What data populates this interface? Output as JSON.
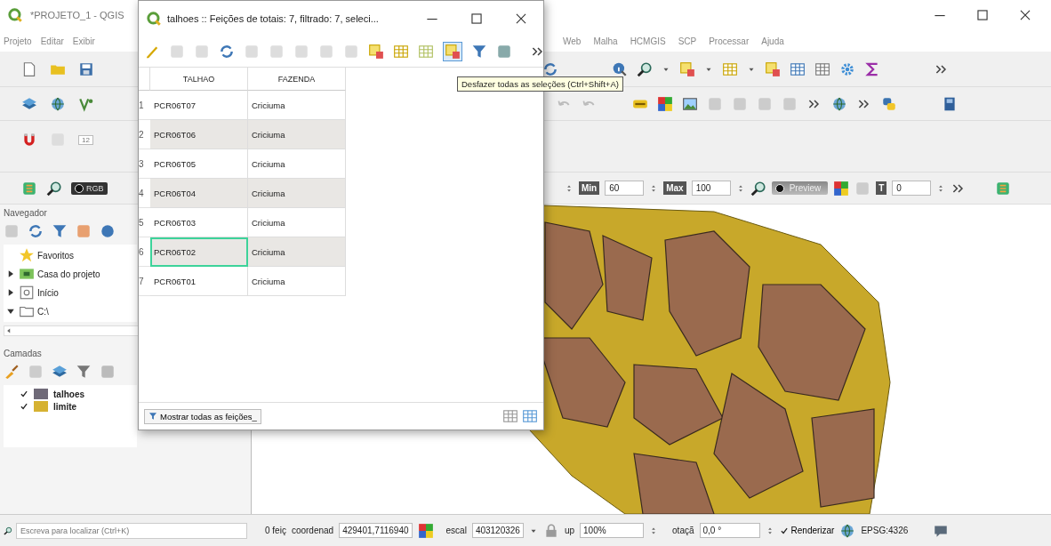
{
  "main_window": {
    "title": "*PROJETO_1 - QGIS"
  },
  "menu_left": [
    "Projeto",
    "Editar",
    "Exibir"
  ],
  "menu_right": [
    "Web",
    "Malha",
    "HCMGIS",
    "SCP",
    "Processar",
    "Ajuda"
  ],
  "raster_toolbar": {
    "band_combo": "RGB",
    "snap_value": "12",
    "min_label": "Min",
    "min_value": "60",
    "max_label": "Max",
    "max_value": "100",
    "preview_label": "Preview",
    "t_label": "T",
    "t_value": "0"
  },
  "browser_panel": {
    "title": "Navegador",
    "items": [
      {
        "label": "Favoritos",
        "kind": "favorites"
      },
      {
        "label": "Casa do projeto",
        "kind": "project",
        "expanded": false
      },
      {
        "label": "Início",
        "kind": "home",
        "expanded": false
      },
      {
        "label": "C:\\",
        "kind": "drive",
        "expanded": true
      }
    ]
  },
  "layers_panel": {
    "title": "Camadas",
    "layers": [
      {
        "name": "talhoes",
        "checked": true,
        "color": "#6f6a78"
      },
      {
        "name": "limite",
        "checked": true,
        "color": "#d6b232"
      }
    ]
  },
  "attribute_table": {
    "title": "talhoes :: Feições de totais: 7, filtrado: 7, seleci...",
    "columns": [
      "TALHAO",
      "FAZENDA"
    ],
    "rows": [
      {
        "number": "1",
        "talhao": "PCR06T07",
        "fazenda": "Criciuma",
        "current": false
      },
      {
        "number": "2",
        "talhao": "PCR06T06",
        "fazenda": "Criciuma",
        "current": false
      },
      {
        "number": "3",
        "talhao": "PCR06T05",
        "fazenda": "Criciuma",
        "current": false
      },
      {
        "number": "4",
        "talhao": "PCR06T04",
        "fazenda": "Criciuma",
        "current": false
      },
      {
        "number": "5",
        "talhao": "PCR06T03",
        "fazenda": "Criciuma",
        "current": false
      },
      {
        "number": "6",
        "talhao": "PCR06T02",
        "fazenda": "Criciuma",
        "current": true
      },
      {
        "number": "7",
        "talhao": "PCR06T01",
        "fazenda": "Criciuma",
        "current": false
      }
    ],
    "filter_button": "Mostrar todas as feições_"
  },
  "tooltip": "Desfazer todas as seleções (Ctrl+Shift+A)",
  "status_bar": {
    "search_placeholder": "Escreva para localizar (Ctrl+K)",
    "features": "0 feiç",
    "coordinate_label": "coordenad",
    "coordinate": "429401,7116940",
    "scale_label": "escal",
    "scale": "403120326",
    "magnifier_label": "up",
    "magnifier": "100%",
    "rotation_label": "otaçã",
    "rotation": "0,0 °",
    "render_label": "Renderizar",
    "render_checked": true,
    "crs": "EPSG:4326"
  }
}
